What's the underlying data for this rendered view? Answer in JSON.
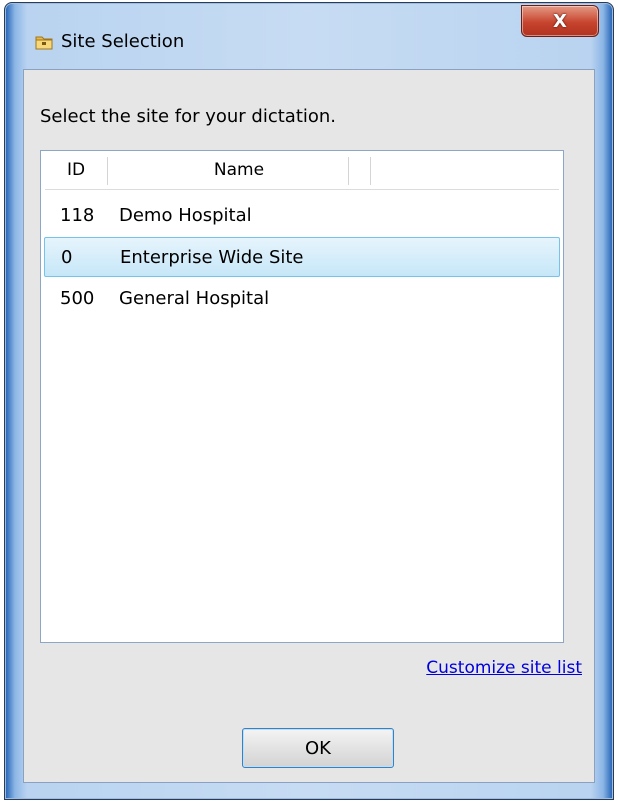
{
  "window": {
    "title": "Site Selection",
    "title_icon": "folder-icon",
    "close_icon": "close-icon",
    "close_glyph": "X"
  },
  "dialog": {
    "prompt": "Select the site for your dictation.",
    "columns": [
      {
        "label": "ID"
      },
      {
        "label": "Name"
      }
    ],
    "rows": [
      {
        "id": "118",
        "name": "Demo Hospital",
        "selected": false
      },
      {
        "id": "0",
        "name": "Enterprise Wide Site",
        "selected": true
      },
      {
        "id": "500",
        "name": "General Hospital",
        "selected": false
      }
    ],
    "link_text": "Customize site list",
    "ok_label": "OK"
  },
  "colors": {
    "selection_fill": "#c6e7f8",
    "selection_border": "#78c1e8",
    "link": "#0000dd",
    "close_button": "#c7442e"
  }
}
